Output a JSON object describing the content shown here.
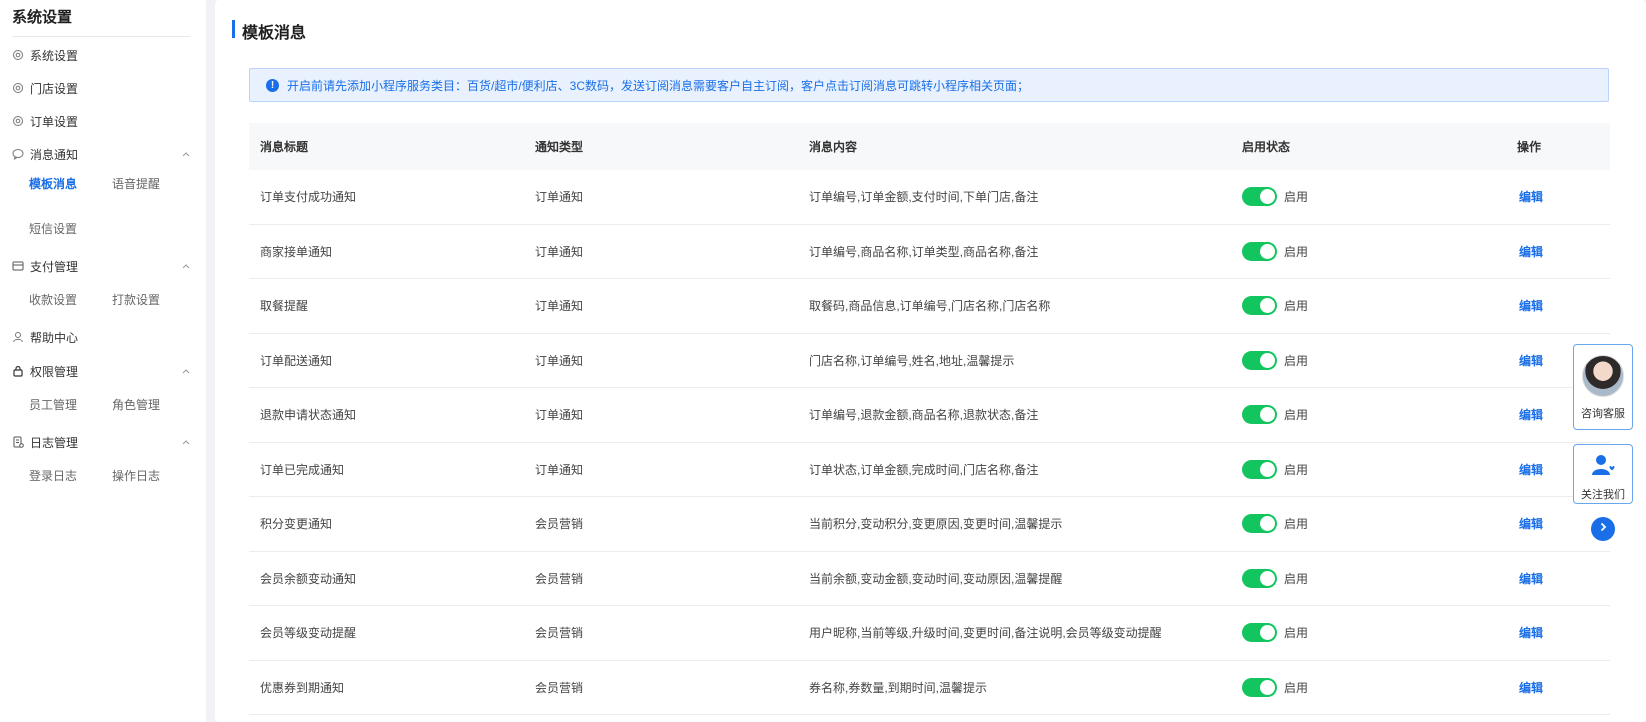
{
  "sidebar": {
    "title": "系统设置",
    "items": [
      {
        "label": "系统设置"
      },
      {
        "label": "门店设置"
      },
      {
        "label": "订单设置"
      },
      {
        "label": "消息通知"
      },
      {
        "label": "支付管理"
      },
      {
        "label": "帮助中心"
      },
      {
        "label": "权限管理"
      },
      {
        "label": "日志管理"
      }
    ],
    "sub_message": [
      "模板消息",
      "语音提醒",
      "短信设置"
    ],
    "sub_payment": [
      "收款设置",
      "打款设置"
    ],
    "sub_permission": [
      "员工管理",
      "角色管理"
    ],
    "sub_log": [
      "登录日志",
      "操作日志"
    ]
  },
  "main": {
    "title": "模板消息",
    "notice": "开启前请先添加小程序服务类目：百货/超市/便利店、3C数码，发送订阅消息需要客户自主订阅，客户点击订阅消息可跳转小程序相关页面；",
    "columns": [
      "消息标题",
      "通知类型",
      "消息内容",
      "启用状态",
      "操作"
    ],
    "rows": [
      {
        "title": "订单支付成功通知",
        "type": "订单通知",
        "content": "订单编号,订单金额,支付时间,下单门店,备注",
        "status": "启用",
        "action": "编辑"
      },
      {
        "title": "商家接单通知",
        "type": "订单通知",
        "content": "订单编号,商品名称,订单类型,商品名称,备注",
        "status": "启用",
        "action": "编辑"
      },
      {
        "title": "取餐提醒",
        "type": "订单通知",
        "content": "取餐码,商品信息,订单编号,门店名称,门店名称",
        "status": "启用",
        "action": "编辑"
      },
      {
        "title": "订单配送通知",
        "type": "订单通知",
        "content": "门店名称,订单编号,姓名,地址,温馨提示",
        "status": "启用",
        "action": "编辑"
      },
      {
        "title": "退款申请状态通知",
        "type": "订单通知",
        "content": "订单编号,退款金额,商品名称,退款状态,备注",
        "status": "启用",
        "action": "编辑"
      },
      {
        "title": "订单已完成通知",
        "type": "订单通知",
        "content": "订单状态,订单金额,完成时间,门店名称,备注",
        "status": "启用",
        "action": "编辑"
      },
      {
        "title": "积分变更通知",
        "type": "会员营销",
        "content": "当前积分,变动积分,变更原因,变更时间,温馨提示",
        "status": "启用",
        "action": "编辑"
      },
      {
        "title": "会员余额变动通知",
        "type": "会员营销",
        "content": "当前余额,变动金额,变动时间,变动原因,温馨提醒",
        "status": "启用",
        "action": "编辑"
      },
      {
        "title": "会员等级变动提醒",
        "type": "会员营销",
        "content": "用户昵称,当前等级,升级时间,变更时间,备注说明,会员等级变动提醒",
        "status": "启用",
        "action": "编辑"
      },
      {
        "title": "优惠券到期通知",
        "type": "会员营销",
        "content": "券名称,券数量,到期时间,温馨提示",
        "status": "启用",
        "action": "编辑"
      }
    ]
  },
  "float": {
    "consult_label": "咨询客服",
    "follow_label": "关注我们"
  },
  "colors": {
    "accent": "#1a6fe8",
    "toggle_on": "#13c55f"
  }
}
